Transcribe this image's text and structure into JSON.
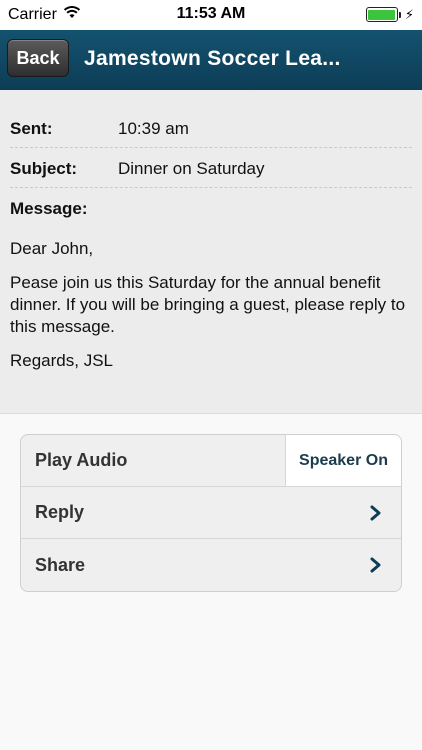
{
  "status": {
    "carrier": "Carrier",
    "time": "11:53 AM",
    "battery_level": 1.0
  },
  "nav": {
    "back_label": "Back",
    "title": "Jamestown Soccer Lea..."
  },
  "message": {
    "sent_label": "Sent:",
    "sent_value": "10:39 am",
    "subject_label": "Subject:",
    "subject_value": "Dinner on Saturday",
    "message_label": "Message:",
    "greeting": "Dear John,",
    "body": "Pease join us this Saturday for the annual benefit dinner. If you will be bringing a guest, please reply to this message.",
    "closing": "Regards, JSL"
  },
  "actions": {
    "play_audio": "Play Audio",
    "speaker": "Speaker On",
    "reply": "Reply",
    "share": "Share"
  },
  "colors": {
    "nav_bar": "#0d3d56",
    "battery": "#3cc43c",
    "chevron": "#0d3d56"
  }
}
